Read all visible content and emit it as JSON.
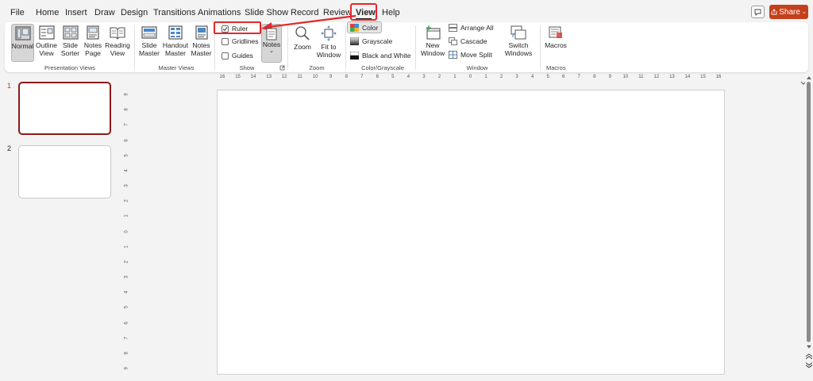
{
  "tabs": [
    "File",
    "Home",
    "Insert",
    "Draw",
    "Design",
    "Transitions",
    "Animations",
    "Slide Show",
    "Record",
    "Review",
    "View",
    "Help"
  ],
  "active_tab": "View",
  "share_label": "Share",
  "ribbon": {
    "presentation_views": {
      "label": "Presentation Views",
      "buttons": [
        {
          "line1": "Normal",
          "line2": ""
        },
        {
          "line1": "Outline",
          "line2": "View"
        },
        {
          "line1": "Slide",
          "line2": "Sorter"
        },
        {
          "line1": "Notes",
          "line2": "Page"
        },
        {
          "line1": "Reading",
          "line2": "View"
        }
      ]
    },
    "master_views": {
      "label": "Master Views",
      "buttons": [
        {
          "line1": "Slide",
          "line2": "Master"
        },
        {
          "line1": "Handout",
          "line2": "Master"
        },
        {
          "line1": "Notes",
          "line2": "Master"
        }
      ]
    },
    "show": {
      "label": "Show",
      "ruler": "Ruler",
      "gridlines": "Gridlines",
      "guides": "Guides",
      "notes": "Notes"
    },
    "zoom": {
      "label": "Zoom",
      "zoom": "Zoom",
      "fit_line1": "Fit to",
      "fit_line2": "Window"
    },
    "color_grayscale": {
      "label": "Color/Grayscale",
      "color": "Color",
      "grayscale": "Grayscale",
      "bw": "Black and White"
    },
    "window": {
      "label": "Window",
      "new_line1": "New",
      "new_line2": "Window",
      "arrange_all": "Arrange All",
      "cascade": "Cascade",
      "move_split": "Move Split",
      "switch_line1": "Switch",
      "switch_line2": "Windows"
    },
    "macros": {
      "label": "Macros",
      "macros": "Macros"
    }
  },
  "slides": [
    "1",
    "2"
  ],
  "hruler_labels": [
    "16",
    "15",
    "14",
    "13",
    "12",
    "11",
    "10",
    "9",
    "8",
    "7",
    "6",
    "5",
    "4",
    "3",
    "2",
    "1",
    "0",
    "1",
    "2",
    "3",
    "4",
    "5",
    "6",
    "7",
    "8",
    "9",
    "10",
    "11",
    "12",
    "13",
    "14",
    "15",
    "16"
  ],
  "vruler_labels": [
    "9",
    "8",
    "7",
    "6",
    "5",
    "4",
    "3",
    "2",
    "1",
    "0",
    "1",
    "2",
    "3",
    "4",
    "5",
    "6",
    "7",
    "8",
    "9"
  ],
  "colors": {
    "accent": "#c4401c",
    "highlight": "#e3282b",
    "active_thumb_border": "#8b1a1a"
  }
}
